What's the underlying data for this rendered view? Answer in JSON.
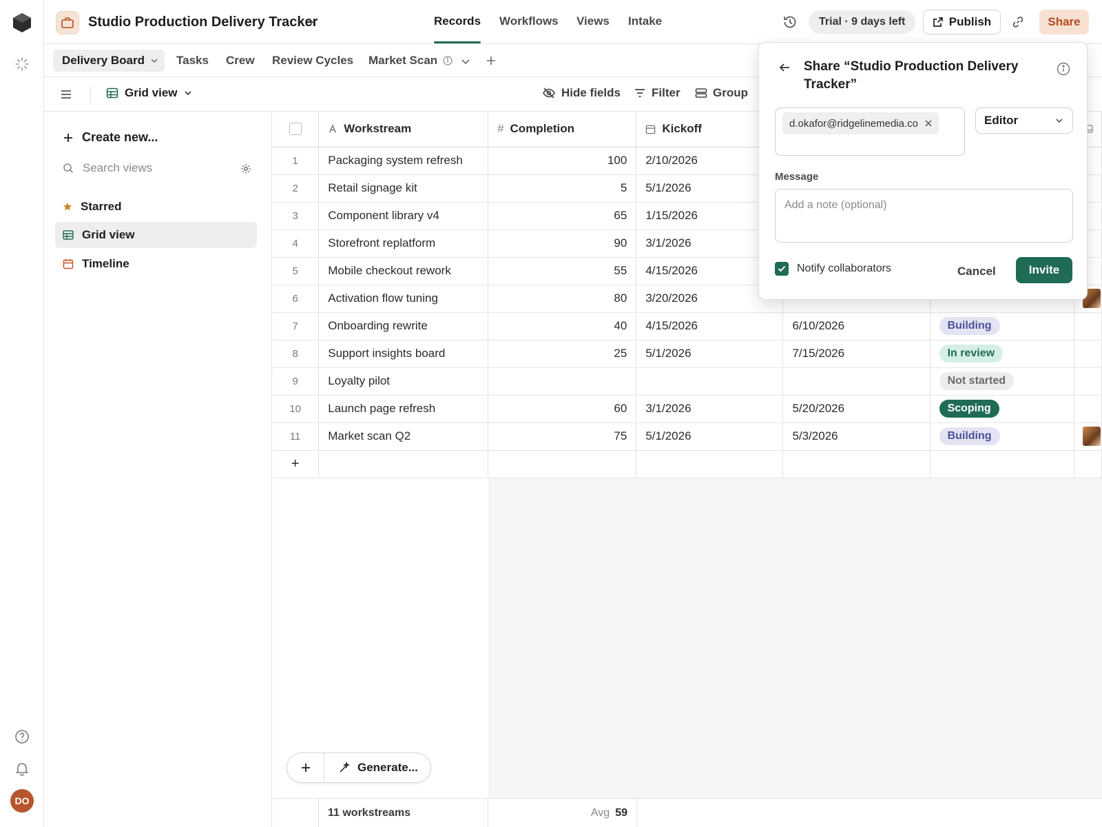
{
  "app": {
    "base_title": "Studio Production Delivery Tracker",
    "nav_tabs": [
      "Records",
      "Workflows",
      "Views",
      "Intake"
    ],
    "active_nav": "Records",
    "trial_text": "Trial · 9 days left",
    "publish_label": "Publish",
    "share_label": "Share",
    "user_initials": "DO"
  },
  "tables": {
    "active": "Delivery Board",
    "others": [
      "Tasks",
      "Crew",
      "Review Cycles",
      "Market Scan"
    ]
  },
  "toolbar": {
    "view_name": "Grid view",
    "hide_fields": "Hide fields",
    "filter": "Filter",
    "group": "Group"
  },
  "sidebar": {
    "create_new": "Create new...",
    "search_placeholder": "Search views",
    "items": [
      {
        "label": "Starred"
      },
      {
        "label": "Grid view"
      },
      {
        "label": "Timeline"
      }
    ]
  },
  "grid": {
    "columns": {
      "workstream": "Workstream",
      "completion": "Completion",
      "kickoff": "Kickoff"
    },
    "rows": [
      {
        "n": "1",
        "name": "Packaging system refresh",
        "completion": "100",
        "kickoff": "2/10/2026",
        "due": "",
        "status": "",
        "thumb": false
      },
      {
        "n": "2",
        "name": "Retail signage kit",
        "completion": "5",
        "kickoff": "5/1/2026",
        "due": "",
        "status": "",
        "thumb": false
      },
      {
        "n": "3",
        "name": "Component library v4",
        "completion": "65",
        "kickoff": "1/15/2026",
        "due": "",
        "status": "",
        "thumb": false
      },
      {
        "n": "4",
        "name": "Storefront replatform",
        "completion": "90",
        "kickoff": "3/1/2026",
        "due": "",
        "status": "",
        "thumb": false
      },
      {
        "n": "5",
        "name": "Mobile checkout rework",
        "completion": "55",
        "kickoff": "4/15/2026",
        "due": "",
        "status": "",
        "thumb": false
      },
      {
        "n": "6",
        "name": "Activation flow tuning",
        "completion": "80",
        "kickoff": "3/20/2026",
        "due": "",
        "status": "",
        "thumb": true
      },
      {
        "n": "7",
        "name": "Onboarding rewrite",
        "completion": "40",
        "kickoff": "4/15/2026",
        "due": "6/10/2026",
        "status": "Building",
        "thumb": false
      },
      {
        "n": "8",
        "name": "Support insights board",
        "completion": "25",
        "kickoff": "5/1/2026",
        "due": "7/15/2026",
        "status": "In review",
        "thumb": false
      },
      {
        "n": "9",
        "name": "Loyalty pilot",
        "completion": "",
        "kickoff": "",
        "due": "",
        "status": "Not started",
        "thumb": false
      },
      {
        "n": "10",
        "name": "Launch page refresh",
        "completion": "60",
        "kickoff": "3/1/2026",
        "due": "5/20/2026",
        "status": "Scoping",
        "thumb": false
      },
      {
        "n": "11",
        "name": "Market scan Q2",
        "completion": "75",
        "kickoff": "5/1/2026",
        "due": "5/3/2026",
        "status": "Building",
        "thumb": true
      }
    ],
    "status_colors": {
      "Building": {
        "bg": "#e3e4f3",
        "fg": "#4b4f9a"
      },
      "In review": {
        "bg": "#d6efe4",
        "fg": "#1f6b55"
      },
      "Not started": {
        "bg": "#ececec",
        "fg": "#6a6a6a"
      },
      "Scoping": {
        "bg": "#1f6b55",
        "fg": "#ffffff"
      }
    },
    "summary": {
      "count": "11 workstreams",
      "avg_label": "Avg",
      "avg_value": "59"
    }
  },
  "floatbar": {
    "generate": "Generate..."
  },
  "share_dialog": {
    "title": "Share “Studio Production Delivery Tracker”",
    "email_chip": "d.okafor@ridgelinemedia.co",
    "role": "Editor",
    "message_label": "Message",
    "message_placeholder": "Add a note (optional)",
    "notify_label": "Notify collaborators",
    "cancel": "Cancel",
    "invite": "Invite"
  },
  "colors": {
    "accent": "#1f6b55",
    "share": "#b14a1f"
  }
}
